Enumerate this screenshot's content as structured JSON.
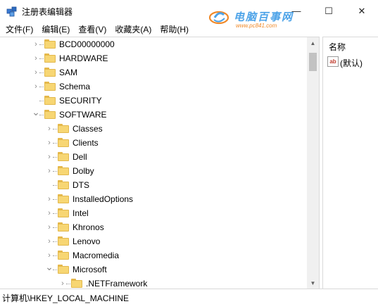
{
  "window": {
    "title": "注册表编辑器",
    "min_glyph": "—",
    "max_glyph": "☐",
    "close_glyph": "✕"
  },
  "watermark": {
    "text": "电脑百事网",
    "url": "www.pc841.com"
  },
  "menu": [
    {
      "label": "文件(F)"
    },
    {
      "label": "编辑(E)"
    },
    {
      "label": "查看(V)"
    },
    {
      "label": "收藏夹(A)"
    },
    {
      "label": "帮助(H)"
    }
  ],
  "tree": [
    {
      "label": "BCD00000000",
      "level": 0,
      "expander": "collapsed"
    },
    {
      "label": "HARDWARE",
      "level": 0,
      "expander": "collapsed"
    },
    {
      "label": "SAM",
      "level": 0,
      "expander": "collapsed"
    },
    {
      "label": "Schema",
      "level": 0,
      "expander": "collapsed"
    },
    {
      "label": "SECURITY",
      "level": 0,
      "expander": "none"
    },
    {
      "label": "SOFTWARE",
      "level": 0,
      "expander": "expanded"
    },
    {
      "label": "Classes",
      "level": 1,
      "expander": "collapsed"
    },
    {
      "label": "Clients",
      "level": 1,
      "expander": "collapsed"
    },
    {
      "label": "Dell",
      "level": 1,
      "expander": "collapsed"
    },
    {
      "label": "Dolby",
      "level": 1,
      "expander": "collapsed"
    },
    {
      "label": "DTS",
      "level": 1,
      "expander": "none"
    },
    {
      "label": "InstalledOptions",
      "level": 1,
      "expander": "collapsed"
    },
    {
      "label": "Intel",
      "level": 1,
      "expander": "collapsed"
    },
    {
      "label": "Khronos",
      "level": 1,
      "expander": "collapsed"
    },
    {
      "label": "Lenovo",
      "level": 1,
      "expander": "collapsed"
    },
    {
      "label": "Macromedia",
      "level": 1,
      "expander": "collapsed"
    },
    {
      "label": "Microsoft",
      "level": 1,
      "expander": "expanded"
    },
    {
      "label": ".NETFramework",
      "level": 2,
      "expander": "collapsed"
    }
  ],
  "values_pane": {
    "column_header": "名称",
    "rows": [
      {
        "icon": "ab",
        "name": "(默认)"
      }
    ]
  },
  "status": {
    "path": "计算机\\HKEY_LOCAL_MACHINE"
  },
  "scrollbar": {
    "up_glyph": "▲",
    "down_glyph": "▼"
  }
}
